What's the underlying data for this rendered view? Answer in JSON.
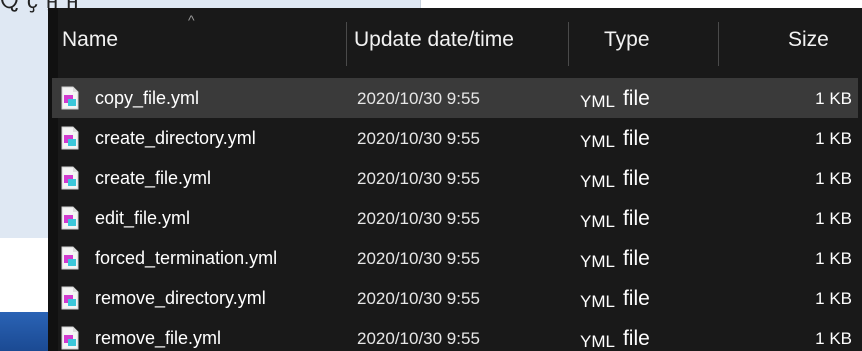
{
  "background": {
    "partial_text": "Ⴍ ҫ ӈ ӈ"
  },
  "header": {
    "name_label": "Name",
    "date_label": "Update date/time",
    "type_label": "Type",
    "size_label": "Size",
    "sort_indicator": "^"
  },
  "files": [
    {
      "name": "copy_file.yml",
      "date": "2020/10/30 9:55",
      "type_prefix": "YML",
      "type_word": "file",
      "size": "1 KB",
      "selected": true
    },
    {
      "name": "create_directory.yml",
      "date": "2020/10/30 9:55",
      "type_prefix": "YML",
      "type_word": "file",
      "size": "1 KB"
    },
    {
      "name": "create_file.yml",
      "date": "2020/10/30 9:55",
      "type_prefix": "YML",
      "type_word": "file",
      "size": "1 KB"
    },
    {
      "name": "edit_file.yml",
      "date": "2020/10/30 9:55",
      "type_prefix": "YML",
      "type_word": "file",
      "size": "1 KB"
    },
    {
      "name": "forced_termination.yml",
      "date": "2020/10/30 9:55",
      "type_prefix": "YML",
      "type_word": "file",
      "size": "1 KB"
    },
    {
      "name": "remove_directory.yml",
      "date": "2020/10/30 9:55",
      "type_prefix": "YML",
      "type_word": "file",
      "size": "1 KB"
    },
    {
      "name": "remove_file.yml",
      "date": "2020/10/30 9:55",
      "type_prefix": "YML",
      "type_word": "file",
      "size": "1 KB"
    }
  ],
  "icons": {
    "file": "yml-file-icon",
    "sort": "sort-ascending-icon"
  },
  "colors": {
    "panel_bg": "#191919",
    "selection": "#3a3a3a",
    "background_window": "#dfe8f3",
    "taskbar": "#1b4a93"
  }
}
